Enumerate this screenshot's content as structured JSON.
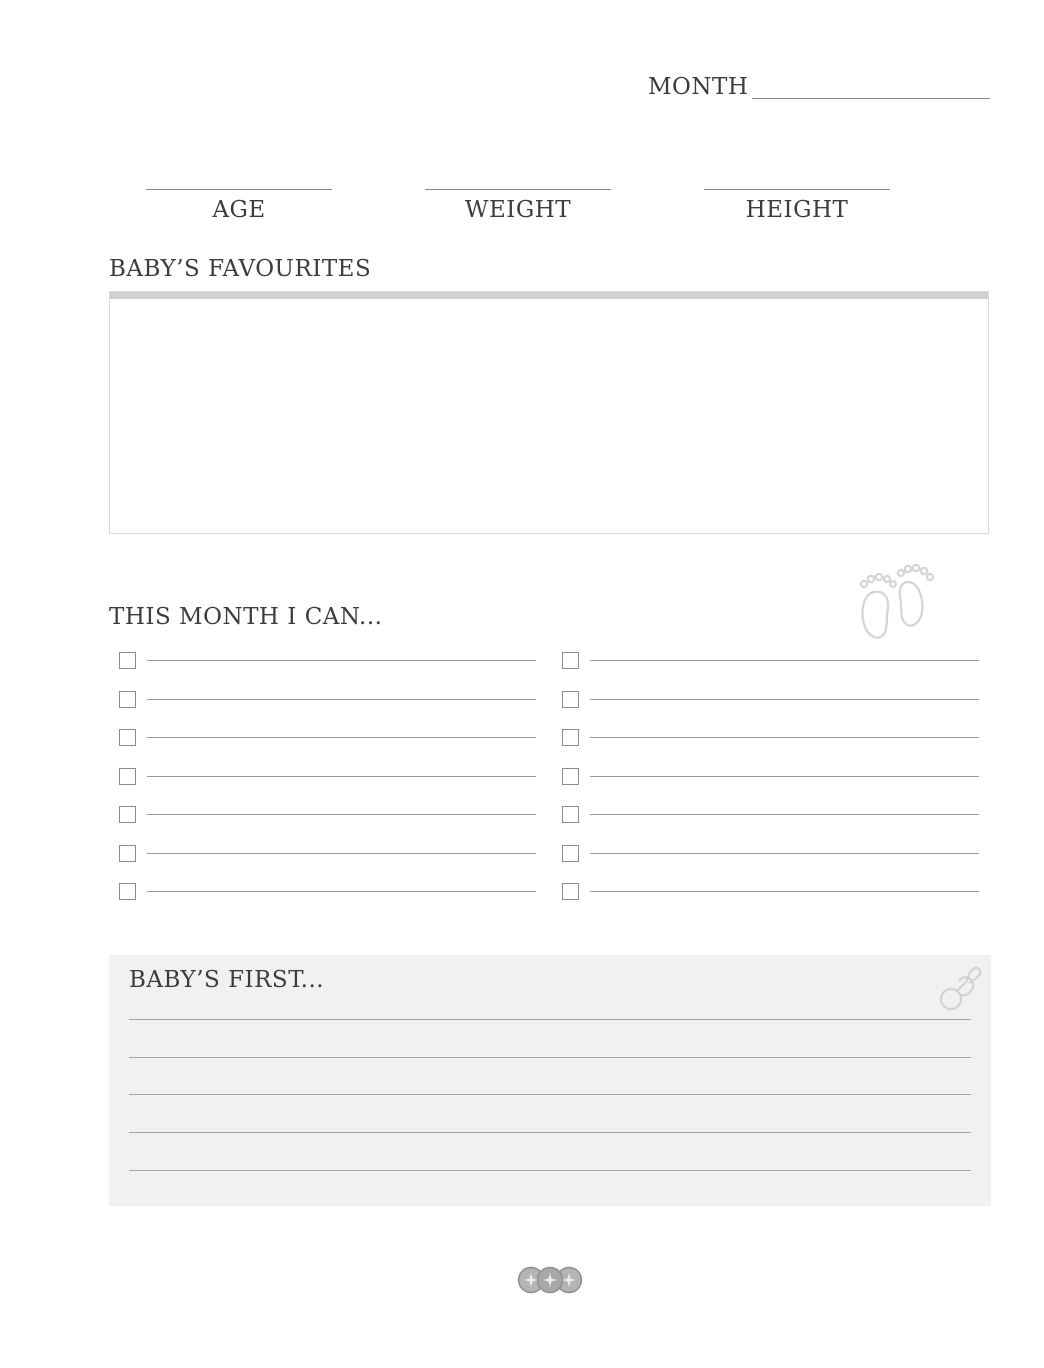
{
  "header": {
    "month_label": "MONTH"
  },
  "stats": [
    {
      "label": "AGE"
    },
    {
      "label": "WEIGHT"
    },
    {
      "label": "HEIGHT"
    }
  ],
  "favourites": {
    "title": "BABY’S FAVOURITES"
  },
  "milestones": {
    "title": "THIS MONTH I CAN...",
    "rows_per_column": 7,
    "columns": 2
  },
  "firsts": {
    "title": "BABY’S FIRST...",
    "line_count": 5
  },
  "icons": {
    "milestones_deco": "baby-feet-icon",
    "firsts_deco": "pacifier-icon",
    "footer_logo": "three-circles-logo-icon"
  },
  "colors": {
    "box_fill": "#f1f1f1",
    "header_bar": "#d0d0d2",
    "rule": "#8a8a8a"
  }
}
